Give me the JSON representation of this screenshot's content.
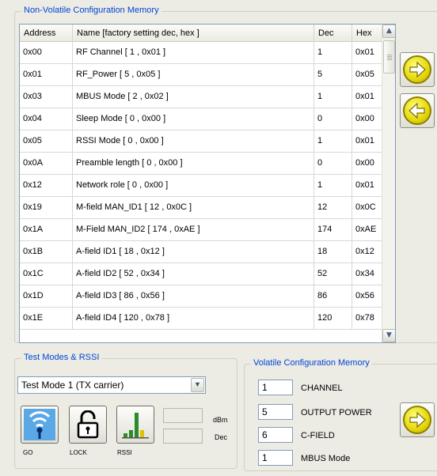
{
  "nvm": {
    "title": "Non-Volatile Configuration Memory",
    "columns": [
      "Address",
      "Name  [factory setting dec, hex ]",
      "Dec",
      "Hex"
    ],
    "rows": [
      {
        "addr": "0x00",
        "name": "RF Channel [ 1 , 0x01 ]",
        "dec": "1",
        "hex": "0x01"
      },
      {
        "addr": "0x01",
        "name": "RF_Power [ 5 , 0x05 ]",
        "dec": "5",
        "hex": "0x05"
      },
      {
        "addr": "0x03",
        "name": "MBUS Mode [ 2 , 0x02 ]",
        "dec": "1",
        "hex": "0x01"
      },
      {
        "addr": "0x04",
        "name": "Sleep Mode [ 0 , 0x00 ]",
        "dec": "0",
        "hex": "0x00"
      },
      {
        "addr": "0x05",
        "name": "RSSI Mode [ 0 , 0x00 ]",
        "dec": "1",
        "hex": "0x01"
      },
      {
        "addr": "0x0A",
        "name": "Preamble length [ 0 , 0x00 ]",
        "dec": "0",
        "hex": "0x00"
      },
      {
        "addr": "0x12",
        "name": "Network role [ 0 , 0x00 ]",
        "dec": "1",
        "hex": "0x01"
      },
      {
        "addr": "0x19",
        "name": "M-field MAN_ID1 [ 12 , 0x0C ]",
        "dec": "12",
        "hex": "0x0C"
      },
      {
        "addr": "0x1A",
        "name": "M-Field MAN_ID2 [ 174 , 0xAE ]",
        "dec": "174",
        "hex": "0xAE"
      },
      {
        "addr": "0x1B",
        "name": "A-field ID1 [ 18 , 0x12 ]",
        "dec": "18",
        "hex": "0x12"
      },
      {
        "addr": "0x1C",
        "name": "A-field ID2 [ 52 , 0x34 ]",
        "dec": "52",
        "hex": "0x34"
      },
      {
        "addr": "0x1D",
        "name": "A-field ID3 [ 86 , 0x56 ]",
        "dec": "86",
        "hex": "0x56"
      },
      {
        "addr": "0x1E",
        "name": "A-field ID4 [ 120 , 0x78 ]",
        "dec": "120",
        "hex": "0x78"
      }
    ],
    "write_icon": "arrow-right-icon",
    "read_icon": "arrow-left-icon"
  },
  "test": {
    "title": "Test Modes & RSSI",
    "mode_selected": "Test Mode 1 (TX carrier)",
    "go_label": "GO",
    "lock_label": "LOCK",
    "rssi_label": "RSSI",
    "dbm_unit": "dBm",
    "dec_unit": "Dec",
    "dbm_value": "",
    "dec_value": ""
  },
  "vol": {
    "title": "Volatile Configuration Memory",
    "fields": [
      {
        "value": "1",
        "label": "CHANNEL"
      },
      {
        "value": "5",
        "label": "OUTPUT POWER"
      },
      {
        "value": "6",
        "label": "C-FIELD"
      },
      {
        "value": "1",
        "label": "MBUS Mode"
      }
    ],
    "apply_icon": "arrow-right-icon"
  },
  "colors": {
    "group_title": "#0046d5",
    "icon_yellow": "#e6d60b",
    "antenna_blue": "#1e6fc4",
    "rssi_green": "#2ea02e"
  }
}
